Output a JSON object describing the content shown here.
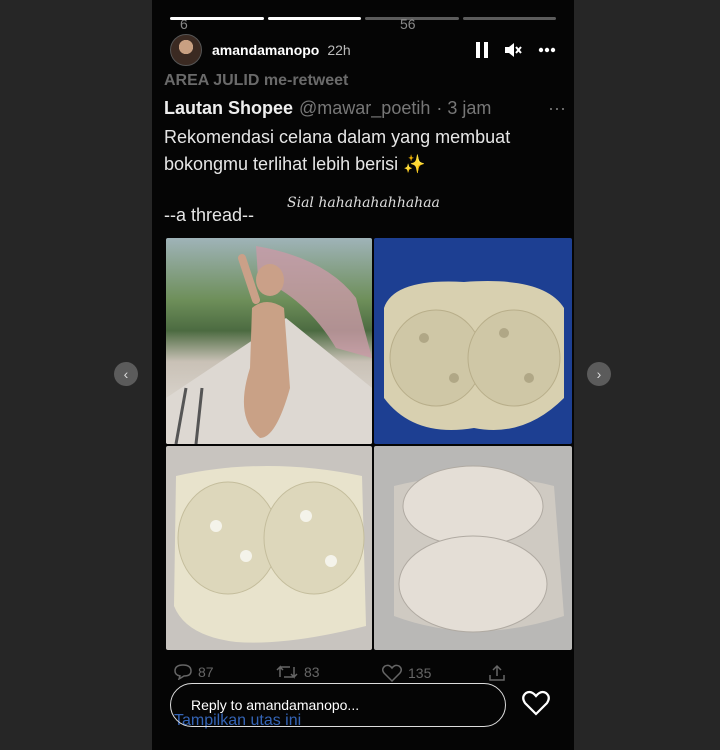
{
  "top_stats": {
    "replies": "6",
    "likes": "56"
  },
  "header": {
    "username": "amandamanopo",
    "time_ago": "22h"
  },
  "tweet": {
    "retweet_label": "AREA JULID me-retweet",
    "author_name": "Lautan Shopee",
    "author_handle": "@mawar_poetih",
    "time": "· 3 jam",
    "more": "···",
    "body_line1": "Rekomendasi celana dalam yang membuat",
    "body_line2": "bokongmu terlihat lebih berisi ✨",
    "thread_label": "--a thread--",
    "handwritten": "Sial hahahahahhahaa",
    "replies": "87",
    "retweets": "83",
    "likes": "135",
    "show_thread": "Tampilkan utas ini"
  },
  "reply_box": {
    "placeholder": "Reply to amandamanopo..."
  },
  "nav": {
    "prev": "‹",
    "next": "›"
  },
  "icons": [
    "pause-icon",
    "mute-icon",
    "more-icon",
    "reply-icon",
    "retweet-icon",
    "like-icon",
    "share-icon",
    "heart-icon",
    "chevron-left-icon",
    "chevron-right-icon"
  ]
}
